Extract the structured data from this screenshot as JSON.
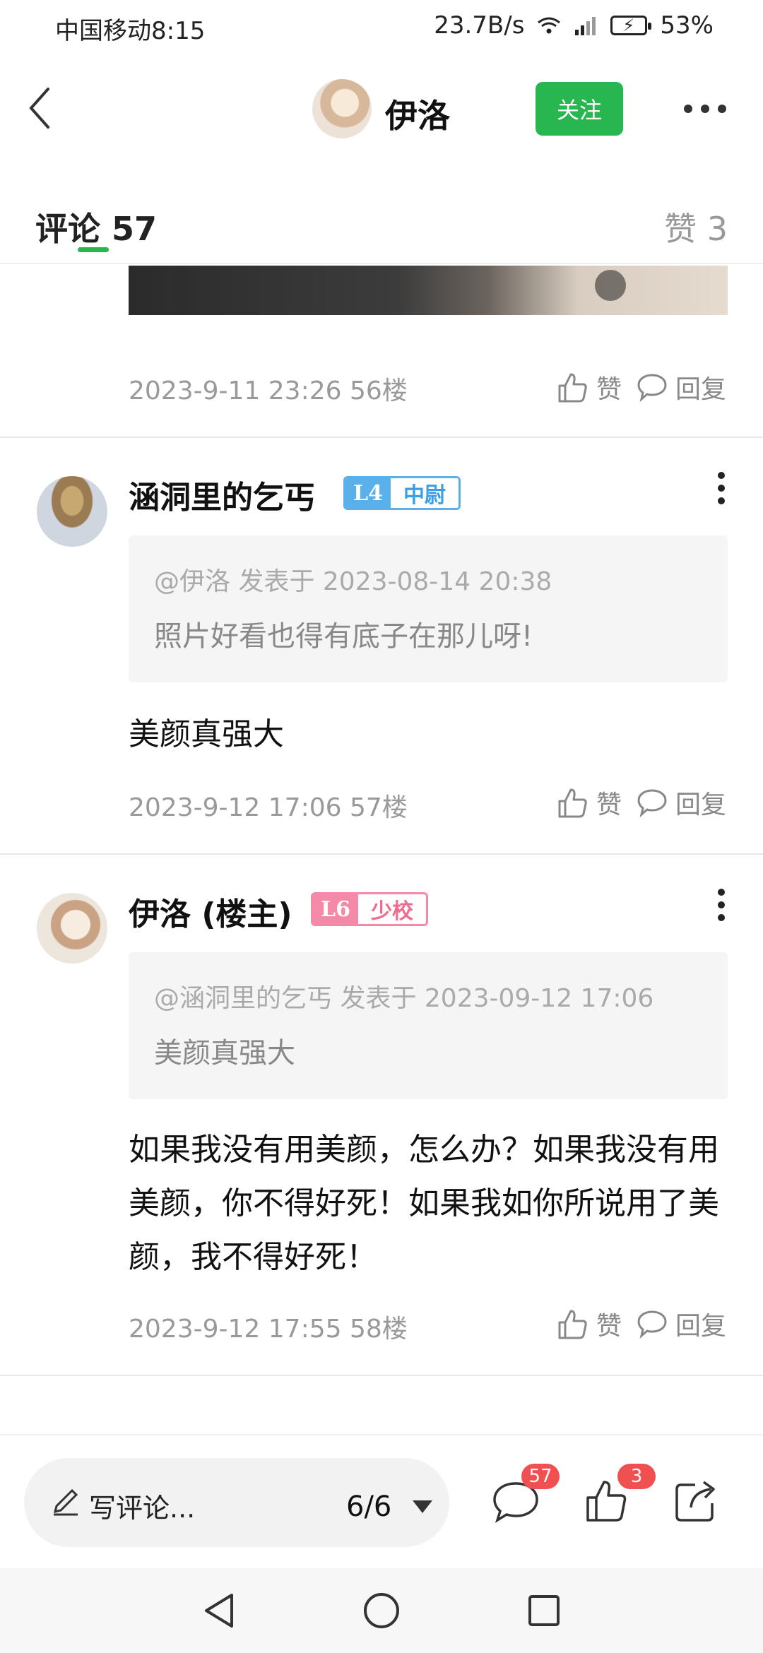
{
  "status": {
    "carrier": "中国移动",
    "time": "8:15",
    "speed": "23.7B/s",
    "battery": "53%"
  },
  "header": {
    "username": "伊洛",
    "follow_label": "关注"
  },
  "tabs": {
    "comments": "评论 57",
    "likes": "赞 3"
  },
  "labels": {
    "like": "赞",
    "reply": "回复"
  },
  "comments": [
    {
      "meta": "2023-9-11 23:26  56楼"
    },
    {
      "author": "涵洞里的乞丐",
      "level": "L4",
      "rank": "中尉",
      "quote_head": "@伊洛 发表于 2023-08-14 20:38",
      "quote_text": "照片好看也得有底子在那儿呀!",
      "text": "美颜真强大",
      "meta": "2023-9-12 17:06  57楼"
    },
    {
      "author": "伊洛 (楼主)",
      "level": "L6",
      "rank": "少校",
      "quote_head": "@涵洞里的乞丐 发表于 2023-09-12 17:06",
      "quote_text": "美颜真强大",
      "text": "如果我没有用美颜，怎么办？如果我没有用美颜，你不得好死！如果我如你所说用了美颜，我不得好死！",
      "meta": "2023-9-12 17:55  58楼"
    }
  ],
  "bottom": {
    "placeholder": "写评论...",
    "page": "6/6",
    "comment_count": "57",
    "like_count": "3"
  },
  "icons": [
    "back-icon",
    "more-icon",
    "thumb-up-icon",
    "reply-icon",
    "pen-icon",
    "comment-icon",
    "share-icon",
    "nav-back-icon",
    "nav-home-icon",
    "nav-recent-icon"
  ],
  "colors": {
    "accent": "#27b650",
    "badge_red": "#f05050",
    "level_blue": "#5ab1ea",
    "level_pink": "#f48aa7"
  }
}
